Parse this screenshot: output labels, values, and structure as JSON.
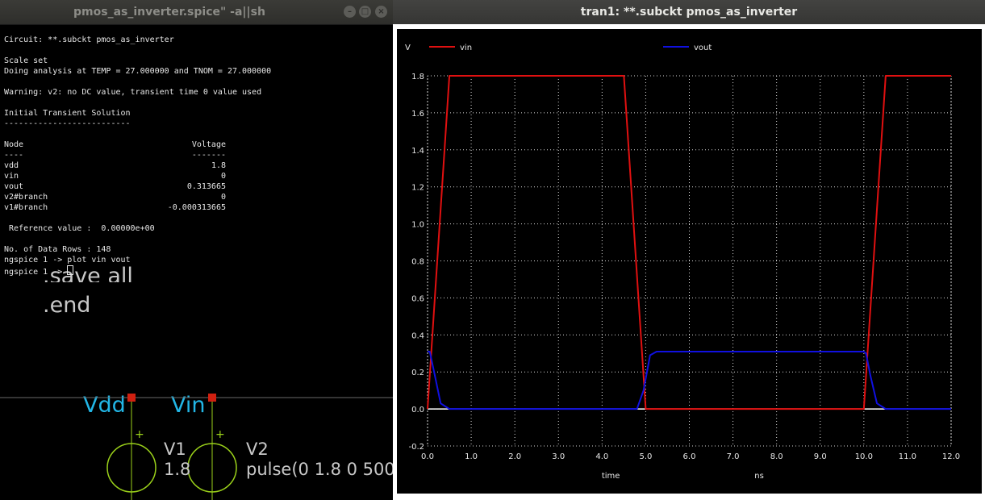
{
  "terminal": {
    "title": "pmos_as_inverter.spice\" -a||sh",
    "lines": [
      {
        "l": "Circuit: **.subckt pmos_as_inverter",
        "r": ""
      },
      {
        "l": "",
        "r": ""
      },
      {
        "l": "Scale set",
        "r": ""
      },
      {
        "l": "Doing analysis at TEMP = 27.000000 and TNOM = 27.000000",
        "r": ""
      },
      {
        "l": "",
        "r": ""
      },
      {
        "l": "Warning: v2: no DC value, transient time 0 value used",
        "r": ""
      },
      {
        "l": "",
        "r": ""
      },
      {
        "l": "Initial Transient Solution",
        "r": ""
      },
      {
        "l": "--------------------------",
        "r": ""
      },
      {
        "l": "",
        "r": ""
      },
      {
        "l": "Node",
        "r": "Voltage"
      },
      {
        "l": "----",
        "r": "-------"
      },
      {
        "l": "vdd",
        "r": "1.8"
      },
      {
        "l": "vin",
        "r": "0"
      },
      {
        "l": "vout",
        "r": "0.313665"
      },
      {
        "l": "v2#branch",
        "r": "0"
      },
      {
        "l": "v1#branch",
        "r": "-0.000313665"
      },
      {
        "l": "",
        "r": ""
      },
      {
        "l": " Reference value :  0.00000e+00",
        "r": ""
      },
      {
        "l": "",
        "r": ""
      },
      {
        "l": "No. of Data Rows : 148",
        "r": ""
      },
      {
        "l": "ngspice 1 -> plot vin vout",
        "r": ""
      },
      {
        "l": "ngspice 1 -> ",
        "r": ""
      }
    ]
  },
  "schematic": {
    "save_text": ".save all",
    "end_text": ".end",
    "net_vdd": "Vdd",
    "net_vin": "Vin",
    "v1_name": "V1",
    "v1_value": "1.8",
    "v2_name": "V2",
    "v2_value": "pulse(0 1.8 0 500"
  },
  "plot": {
    "title": "tran1: **.subckt pmos_as_inverter",
    "colors": {
      "bg": "#000000",
      "grid": "#d8d8d8",
      "vin": "#e01010",
      "vout": "#1010e0",
      "zero": "#ffffff"
    }
  },
  "chart_data": {
    "type": "line",
    "ylabel": "V",
    "xlabel": "time",
    "xunit": "ns",
    "xlim": [
      0,
      12
    ],
    "ylim": [
      -0.2,
      1.8
    ],
    "xticks": [
      "0.0",
      "1.0",
      "2.0",
      "3.0",
      "4.0",
      "5.0",
      "6.0",
      "7.0",
      "8.0",
      "9.0",
      "10.0",
      "11.0",
      "12.0"
    ],
    "yticks": [
      "1.8",
      "1.6",
      "1.4",
      "1.2",
      "1.0",
      "0.8",
      "0.6",
      "0.4",
      "0.2",
      "0.0",
      "-0.2"
    ],
    "grid": true,
    "legend": "top",
    "series": [
      {
        "name": "vin",
        "x": [
          0,
          0.5,
          4.5,
          5.0,
          10.0,
          10.5,
          12.0
        ],
        "y": [
          0,
          1.8,
          1.8,
          0,
          0,
          1.8,
          1.8
        ]
      },
      {
        "name": "vout",
        "x": [
          0,
          0.05,
          0.15,
          0.3,
          0.5,
          4.8,
          4.95,
          5.1,
          5.25,
          10.0,
          10.05,
          10.15,
          10.3,
          10.5,
          12.0
        ],
        "y": [
          0.31,
          0.31,
          0.2,
          0.03,
          0,
          0,
          0.1,
          0.29,
          0.31,
          0.31,
          0.3,
          0.18,
          0.03,
          0,
          0
        ]
      }
    ]
  }
}
